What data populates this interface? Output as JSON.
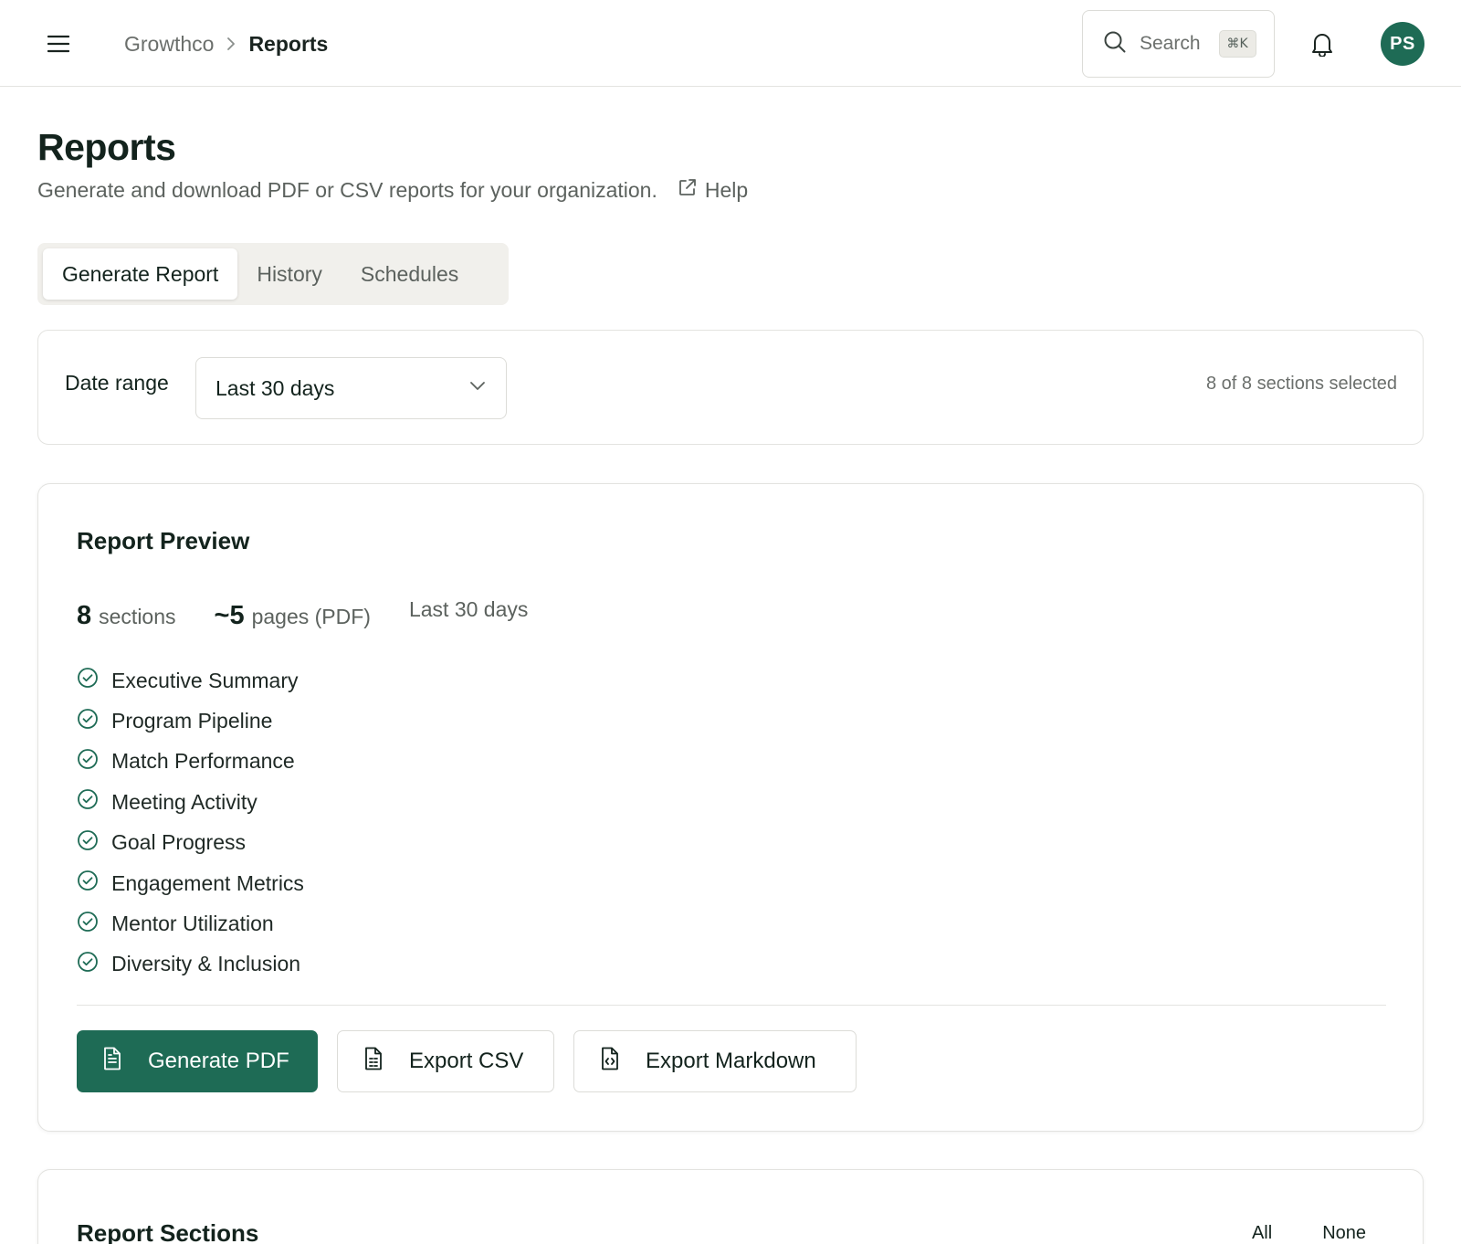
{
  "topbar": {
    "breadcrumb": {
      "org": "Growthco",
      "current": "Reports"
    },
    "search": {
      "label": "Search",
      "shortcut": "⌘K"
    },
    "avatar_initials": "PS"
  },
  "page": {
    "title": "Reports",
    "subtitle": "Generate and download PDF or CSV reports for your organization.",
    "help_label": "Help"
  },
  "tabs": [
    {
      "label": "Generate Report",
      "active": true
    },
    {
      "label": "History",
      "active": false
    },
    {
      "label": "Schedules",
      "active": false
    }
  ],
  "filters": {
    "date_range_label": "Date range",
    "date_range_value": "Last 30 days",
    "selected_summary": "8 of 8 sections selected"
  },
  "preview": {
    "title": "Report Preview",
    "sections_count": "8",
    "sections_label": "sections",
    "pages_count": "~5",
    "pages_label": "pages (PDF)",
    "range_label": "Last 30 days",
    "sections": [
      "Executive Summary",
      "Program Pipeline",
      "Match Performance",
      "Meeting Activity",
      "Goal Progress",
      "Engagement Metrics",
      "Mentor Utilization",
      "Diversity & Inclusion"
    ],
    "actions": {
      "pdf": "Generate PDF",
      "csv": "Export CSV",
      "markdown": "Export Markdown"
    }
  },
  "sections_card": {
    "title": "Report Sections",
    "all_label": "All",
    "none_label": "None"
  },
  "colors": {
    "brand": "#1e6b55",
    "text": "#13231d",
    "muted": "#5c625e",
    "border": "#e3e3e0"
  }
}
